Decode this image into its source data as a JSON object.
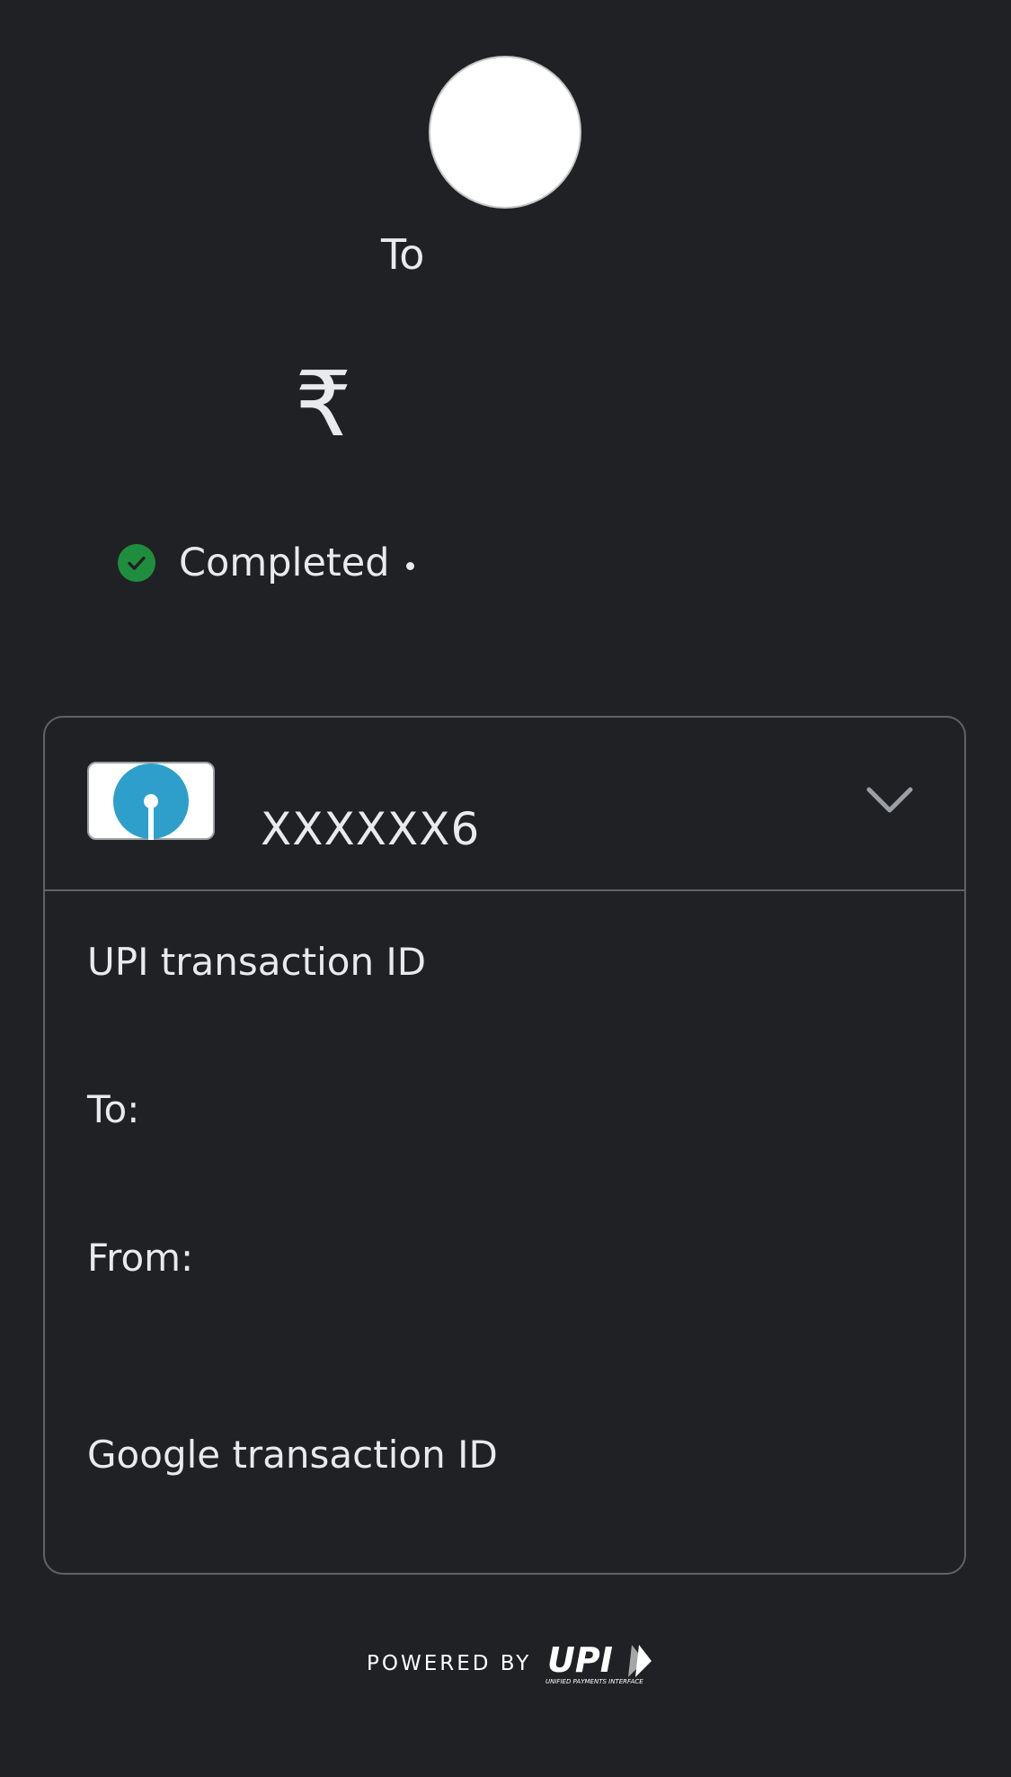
{
  "header": {
    "to_label": "To",
    "currency_symbol": "₹"
  },
  "status": {
    "text": "Completed",
    "color": "#1e8e3e"
  },
  "account_card": {
    "account_number": "XXXXXX6",
    "bank_logo": "sbi-bank-logo",
    "expand_icon": "chevron-down-icon"
  },
  "details": {
    "upi_transaction_id_label": "UPI transaction ID",
    "to_label": "To:",
    "from_label": "From:",
    "google_transaction_id_label": "Google transaction ID"
  },
  "footer": {
    "powered_by": "POWERED BY",
    "upi_logo": "UPI",
    "upi_tagline": "UNIFIED PAYMENTS INTERFACE"
  },
  "colors": {
    "background": "#202124",
    "text": "#e8eaed",
    "border": "#5f6368",
    "bank_blue": "#2d9fca"
  }
}
